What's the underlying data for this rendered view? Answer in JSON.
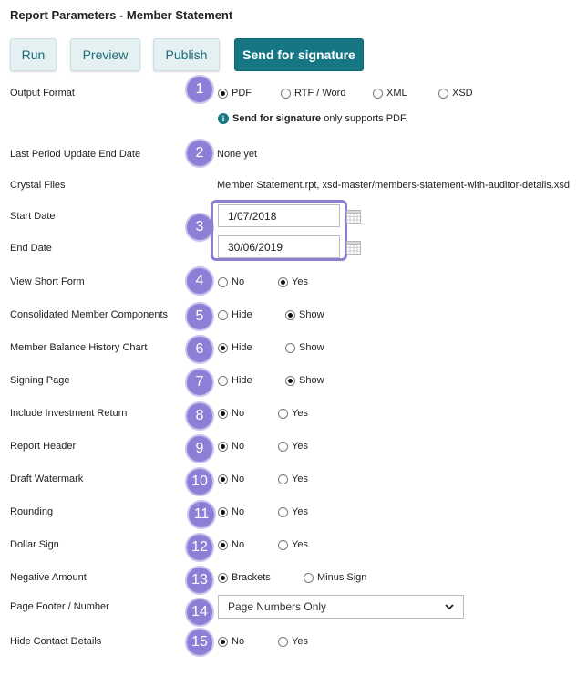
{
  "title": "Report Parameters - Member Statement",
  "toolbar": {
    "run": "Run",
    "preview": "Preview",
    "publish": "Publish",
    "send": "Send for signature"
  },
  "badge_color": "#8e7fd6",
  "accent": "#167683",
  "steps": [
    "1",
    "2",
    "3",
    "4",
    "5",
    "6",
    "7",
    "8",
    "9",
    "10",
    "11",
    "12",
    "13",
    "14",
    "15"
  ],
  "output_format": {
    "label": "Output Format",
    "options": [
      "PDF",
      "RTF / Word",
      "XML",
      "XSD"
    ],
    "selected": "PDF",
    "note_strong": "Send for signature",
    "note_rest": " only supports PDF."
  },
  "last_period": {
    "label": "Last Period Update End Date",
    "value": "None yet"
  },
  "crystal_files": {
    "label": "Crystal Files",
    "value": "Member Statement.rpt, xsd-master/members-statement-with-auditor-details.xsd"
  },
  "start_date": {
    "label": "Start Date",
    "value": "1/07/2018"
  },
  "end_date": {
    "label": "End Date",
    "value": "30/06/2019"
  },
  "view_short_form": {
    "label": "View Short Form",
    "options": [
      "No",
      "Yes"
    ],
    "selected": "Yes"
  },
  "consolidated": {
    "label": "Consolidated Member Components",
    "options": [
      "Hide",
      "Show"
    ],
    "selected": "Show"
  },
  "balance_history": {
    "label": "Member Balance History Chart",
    "options": [
      "Hide",
      "Show"
    ],
    "selected": "Hide"
  },
  "signing_page": {
    "label": "Signing Page",
    "options": [
      "Hide",
      "Show"
    ],
    "selected": "Show"
  },
  "investment_return": {
    "label": "Include Investment Return",
    "options": [
      "No",
      "Yes"
    ],
    "selected": "No"
  },
  "report_header": {
    "label": "Report Header",
    "options": [
      "No",
      "Yes"
    ],
    "selected": "No"
  },
  "draft_watermark": {
    "label": "Draft Watermark",
    "options": [
      "No",
      "Yes"
    ],
    "selected": "No"
  },
  "rounding": {
    "label": "Rounding",
    "options": [
      "No",
      "Yes"
    ],
    "selected": "No"
  },
  "dollar_sign": {
    "label": "Dollar Sign",
    "options": [
      "No",
      "Yes"
    ],
    "selected": "No"
  },
  "negative_amount": {
    "label": "Negative Amount",
    "options": [
      "Brackets",
      "Minus Sign"
    ],
    "selected": "Brackets"
  },
  "page_footer": {
    "label": "Page Footer / Number",
    "value": "Page Numbers Only"
  },
  "hide_contact": {
    "label": "Hide Contact Details",
    "options": [
      "No",
      "Yes"
    ],
    "selected": "No"
  },
  "icons": {
    "info": "info-icon",
    "calendar": "calendar-icon",
    "dropdown": "chevron-down-icon",
    "info_glyph": "i"
  }
}
